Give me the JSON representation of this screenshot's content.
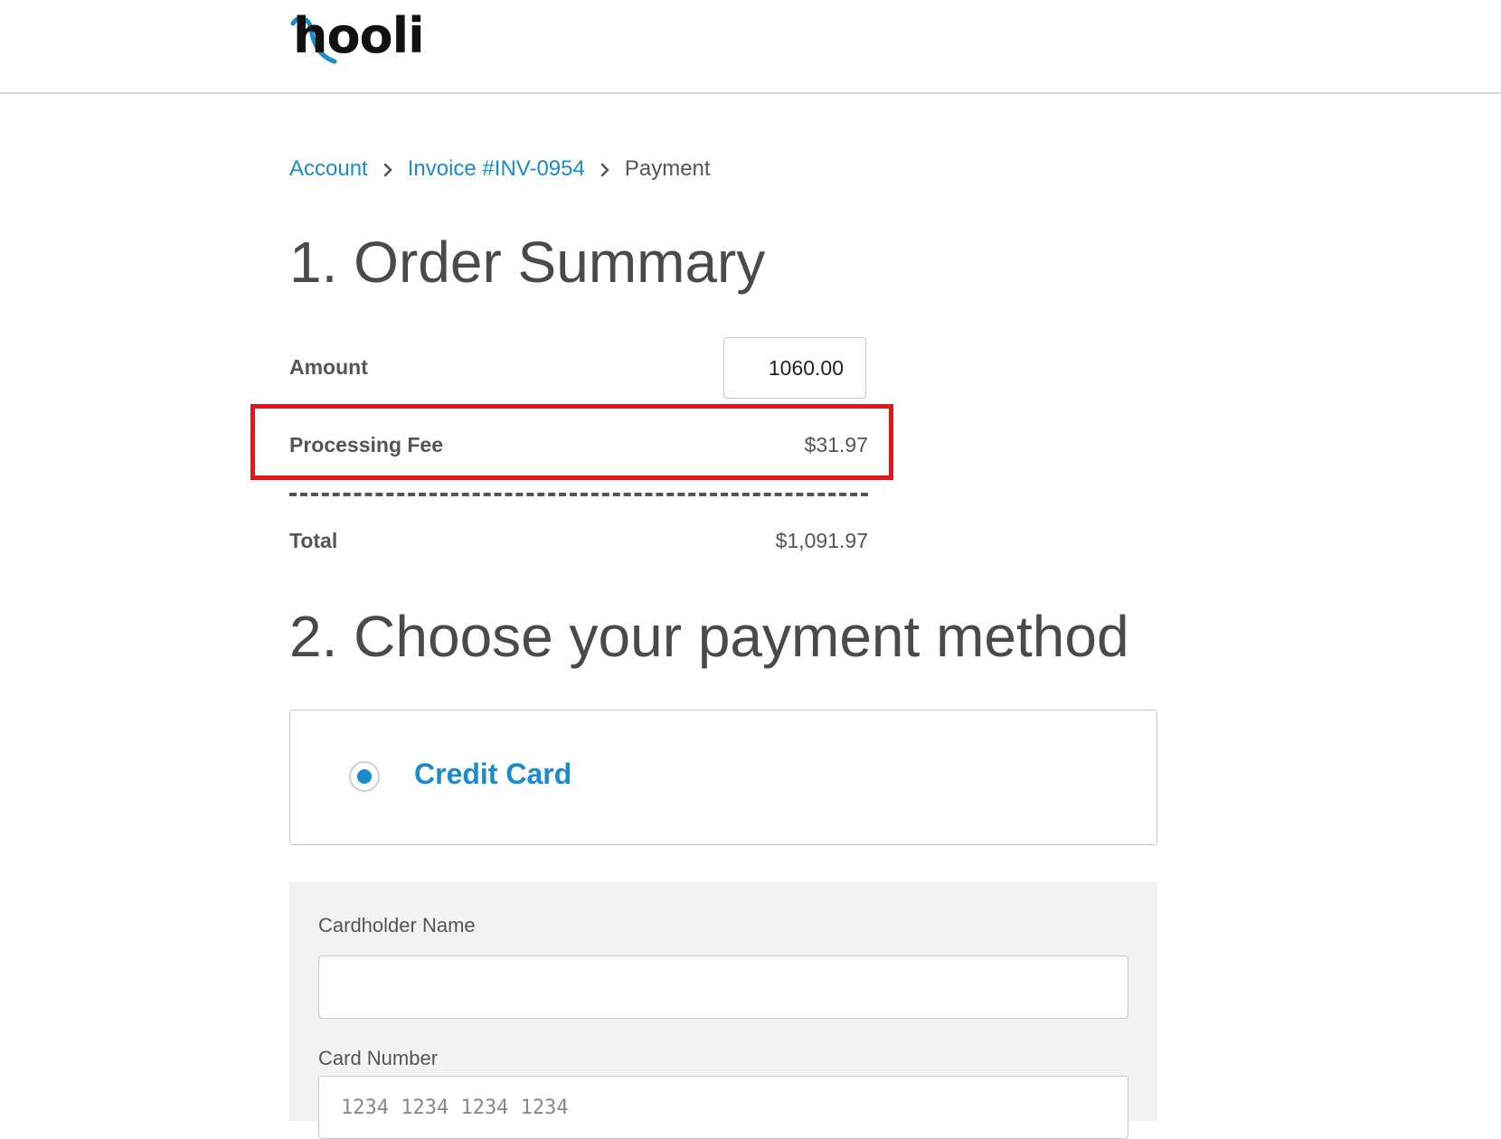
{
  "brand": {
    "logo_text": "hooli",
    "accent_color": "#1a8bcc",
    "highlight_color": "#e8141c"
  },
  "breadcrumb": {
    "items": [
      {
        "label": "Account"
      },
      {
        "label": "Invoice #INV-0954"
      },
      {
        "label": "Payment"
      }
    ],
    "separator_icon": "chevron-right-icon"
  },
  "order_summary": {
    "title": "1. Order Summary",
    "amount_label": "Amount",
    "amount_value": "1060.00",
    "fee_label": "Processing Fee",
    "fee_value": "$31.97",
    "total_label": "Total",
    "total_value": "$1,091.97"
  },
  "payment_method": {
    "title": "2. Choose your payment method",
    "options": [
      {
        "label": "Credit Card",
        "selected": true
      }
    ]
  },
  "card_form": {
    "cardholder_label": "Cardholder Name",
    "cardholder_value": "",
    "card_number_label": "Card Number",
    "card_number_placeholder": "1234 1234 1234 1234"
  }
}
